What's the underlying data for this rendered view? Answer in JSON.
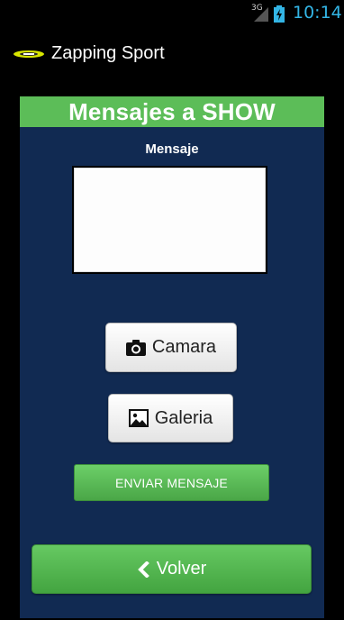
{
  "status_bar": {
    "network": "3G",
    "time": "10:14",
    "accent_color": "#33b5e5"
  },
  "action_bar": {
    "title": "Zapping Sport",
    "logo_icon": "zapping-sport-logo"
  },
  "panel": {
    "header_title": "Mensajes a SHOW",
    "header_color": "#5cbd58",
    "background_color": "#112a52",
    "message_label": "Mensaje",
    "message_value": ""
  },
  "buttons": {
    "camara": {
      "label": "Camara",
      "icon": "camera-icon"
    },
    "galeria": {
      "label": "Galeria",
      "icon": "image-icon"
    },
    "enviar": {
      "label": "ENVIAR MENSAJE"
    },
    "volver": {
      "label": "Volver",
      "icon": "chevron-left-icon"
    }
  }
}
